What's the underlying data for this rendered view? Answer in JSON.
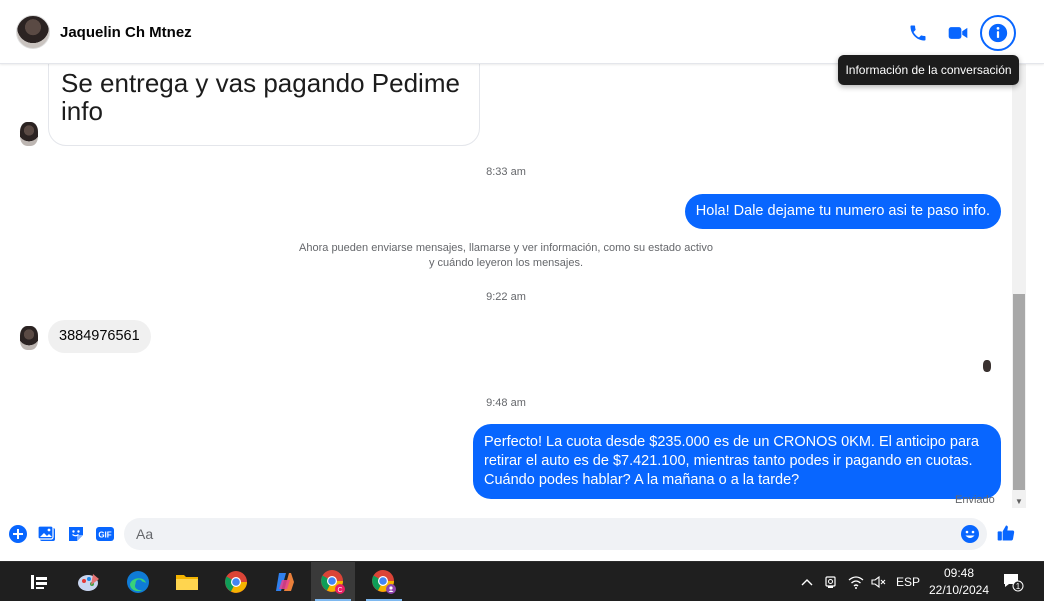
{
  "header": {
    "contact_name": "Jaquelin Ch Mtnez",
    "tooltip": "Información de la conversación",
    "buttons": {
      "call": "phone-icon",
      "video": "video-camera-icon",
      "info": "info-icon"
    }
  },
  "thread": {
    "previous_message_lines": [
      "Se entrega y vas pagando Pedime",
      "info"
    ],
    "time_1": "8:33 am",
    "outgoing_1": "Hola! Dale dejame tu numero  asi te paso info.",
    "system_notice_line1": "Ahora pueden enviarse mensajes, llamarse y ver información, como su estado activo",
    "system_notice_line2": "y cuándo leyeron los mensajes.",
    "time_2": "9:22 am",
    "incoming_1": "3884976561",
    "time_3": "9:48 am",
    "outgoing_2": "Perfecto! La cuota desde $235.000 es de un CRONOS 0KM. El anticipo para retirar el auto es de $7.421.100, mientras tanto podes ir pagando en cuotas. Cuándo podes hablar? A la mañana o a la tarde?",
    "status": "Enviado"
  },
  "composer": {
    "placeholder": "Aa",
    "gif_label": "GIF"
  },
  "taskbar": {
    "language": "ESP",
    "time": "09:48",
    "date": "22/10/2024",
    "notification_count": "1"
  },
  "colors": {
    "accent": "#0866ff",
    "incoming_bubble": "#f0f0f0",
    "taskbar": "#1f1f1f"
  }
}
